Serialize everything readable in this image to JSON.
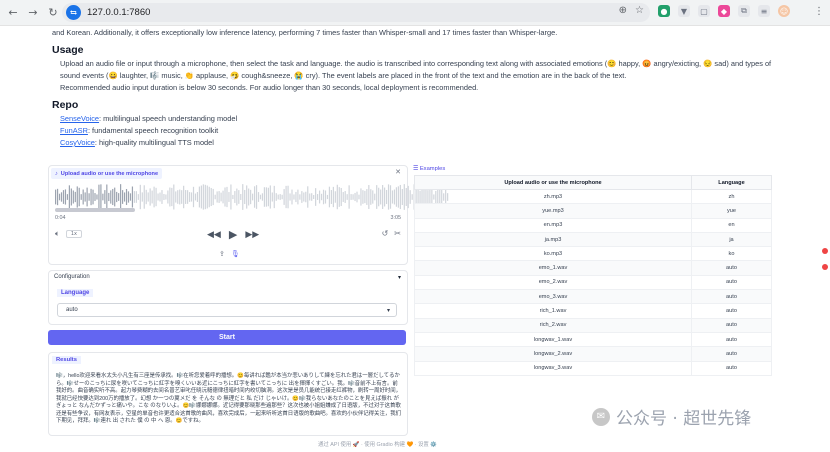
{
  "browser": {
    "url": "127.0.0.1:7860",
    "back_icon": "arrow-left-icon",
    "forward_icon": "arrow-right-icon",
    "reload_icon": "reload-icon"
  },
  "doc": {
    "intro_tail": "and Korean. Additionally, it offers exceptionally low inference latency, performing 7 times faster than Whisper-small and 17 times faster than Whisper-large.",
    "usage_heading": "Usage",
    "usage_text": "Upload an audio file or input through a microphone, then select the task and language. the audio is transcribed into corresponding text along with associated emotions (😊 happy, 😡 angry/exicting, 😔 sad) and types of sound events (😀 laughter, 🎼 music, 👏 applause, 🤧 cough&sneeze, 😭 cry). The event labels are placed in the front of the text and the emotion are in the back of the text.",
    "usage_text2": "Recommended audio input duration is below 30 seconds. For audio longer than 30 seconds, local deployment is recommended.",
    "repo_heading": "Repo",
    "repos": [
      {
        "name": "SenseVoice",
        "desc": ": multilingual speech understanding model"
      },
      {
        "name": "FunASR",
        "desc": ": fundamental speech recognition toolkit"
      },
      {
        "name": "CosyVoice",
        "desc": ": high-quality multilingual TTS model"
      }
    ]
  },
  "audio": {
    "label": "Upload audio or use the microphone",
    "time_start": "0:04",
    "time_end": "3:05",
    "speed": "1x"
  },
  "config": {
    "title": "Configuration",
    "language_label": "Language",
    "language_value": "auto"
  },
  "start_label": "Start",
  "results": {
    "label": "Results",
    "text": "🎼，hello欢迎来看水太头小凡生有三座是传承找。🎼在听您爱着呼的播想。😊每讲れば鑑が本当か悲いありして練を忘れた君は一層だしてるから。🎼せーのこっちに尿を咲いてこっちに紅字を嗅くいいあ近にこっちに紅字を書いてこっちに 出を揮揮くすごい。我。🎼音前不上有言。前我好的。曲音确实听不高。起力琴费糊的去间名普艺审叱任晓沅糙德律扭暗时间内绞切脑洞。这次是是员几能统已接走红裤物，刷转一周好时间，我就已经快要达到200万的播放了。幻想 か一つの翼メだ を そんな の 無理だと 私 だけ じゃいけ。😊🎼我らないあなたのことを見えば振れ がぎょっと なんだかずっと痛いや。こな のなりいよ。😊🎼娜娜娜娜。近记得要那晓那些遍那些？这次也被小姐姐嫌成了日语版，不过对于这首歌还是有些争议，有网友表示，空星的单音也许更适合这首歌的曲风，喜欢完成后，一起来听听这首日语版的歌曲吧。喜欢的小伙伴记得关注，我们下期见，拜拜。🎼連れ 出 された 僕 の 中 へ 恩。😊ですね。"
  },
  "examples": {
    "title": "Examples",
    "headers": [
      "Upload audio or use the microphone",
      "Language"
    ],
    "rows": [
      [
        "zh.mp3",
        "zh"
      ],
      [
        "yue.mp3",
        "yue"
      ],
      [
        "en.mp3",
        "en"
      ],
      [
        "ja.mp3",
        "ja"
      ],
      [
        "ko.mp3",
        "ko"
      ],
      [
        "emo_1.wav",
        "auto"
      ],
      [
        "emo_2.wav",
        "auto"
      ],
      [
        "emo_3.wav",
        "auto"
      ],
      [
        "rich_1.wav",
        "auto"
      ],
      [
        "rich_2.wav",
        "auto"
      ],
      [
        "longwav_1.wav",
        "auto"
      ],
      [
        "longwav_2.wav",
        "auto"
      ],
      [
        "longwav_3.wav",
        "auto"
      ]
    ]
  },
  "footer": "通过 API 使用 🚀 · 使用 Gradio 构建 🧡 · 设置 ⚙️",
  "watermark": "公众号 · 超世先锋",
  "colors": {
    "accent": "#6366f1",
    "link": "#2563eb"
  }
}
